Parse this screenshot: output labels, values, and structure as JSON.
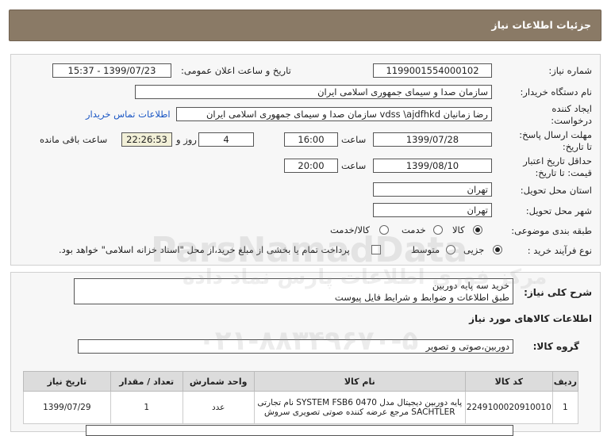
{
  "header": {
    "title": "جزئیات اطلاعات نیاز"
  },
  "form": {
    "need_number_label": "شماره نیاز:",
    "need_number": "1199001554000102",
    "announce_label": "تاریخ و ساعت اعلان عمومی:",
    "announce_value": "1399/07/23 - 15:37",
    "buyer_org_label": "نام دستگاه خریدار:",
    "buyer_org": "سازمان صدا و سیمای جمهوری اسلامی ایران",
    "creator_label_1": "ایجاد کننده",
    "creator_label_2": "درخواست:",
    "creator_value": "رضا زمانیان vdss \\ajdfhkd سازمان صدا و سیمای جمهوری اسلامی ایران",
    "contact_link": "اطلاعات تماس خریدار",
    "deadline_label_1": "مهلت ارسال پاسخ:",
    "deadline_label_2": "تا تاریخ:",
    "deadline_date": "1399/07/28",
    "time_label": "ساعت",
    "deadline_time": "16:00",
    "days_value": "4",
    "days_label": "روز و",
    "remaining_time": "22:26:53",
    "remaining_label": "ساعت باقی مانده",
    "validity_label_1": "حداقل تاریخ اعتبار",
    "validity_label_2": "قیمت: تا تاریخ:",
    "validity_date": "1399/08/10",
    "validity_time": "20:00",
    "province_label": "استان محل تحویل:",
    "province": "تهران",
    "city_label": "شهر محل تحویل:",
    "city": "تهران",
    "category_label": "طبقه بندی موضوعی:",
    "category_options": [
      "کالا",
      "خدمت",
      "کالا/خدمت"
    ],
    "process_label": "نوع فرآیند خرید :",
    "process_options": [
      "جزیی",
      "متوسط"
    ],
    "payment_note": "پرداخت تمام یا بخشی از مبلغ خرید،از محل \"اسناد خزانه اسلامی\" خواهد بود."
  },
  "description": {
    "label": "شرح کلی نیاز:",
    "line1": "خرید سه پایه دوربین",
    "line2": "طبق اطلاعات و ضوابط و شرایط فایل پیوست"
  },
  "goods": {
    "section_title": "اطلاعات کالاهای مورد نیاز",
    "group_label": "گروه کالا:",
    "group_value": "دوربین،صوتی و تصویر",
    "columns": [
      "ردیف",
      "کد کالا",
      "نام کالا",
      "واحد شمارش",
      "تعداد / مقدار",
      "تاریخ نیاز"
    ],
    "rows": [
      {
        "row": "1",
        "code": "2249100020910010",
        "name_line1": "پایه دوربین دیجیتال مدل SYSTEM FSB6 0470 نام تجارتی",
        "name_line2": "SACHTLER مرجع عرضه کننده صوتی تصویری سروش",
        "unit": "عدد",
        "qty": "1",
        "date": "1399/07/29"
      }
    ]
  },
  "watermark": {
    "line1": "ParsNamadData",
    "line2": "مرکز فوری اطلاعات پارس نماد داده",
    "line3": "۰۲۱-۸۸۳۴۹۶۷۰-۵"
  }
}
